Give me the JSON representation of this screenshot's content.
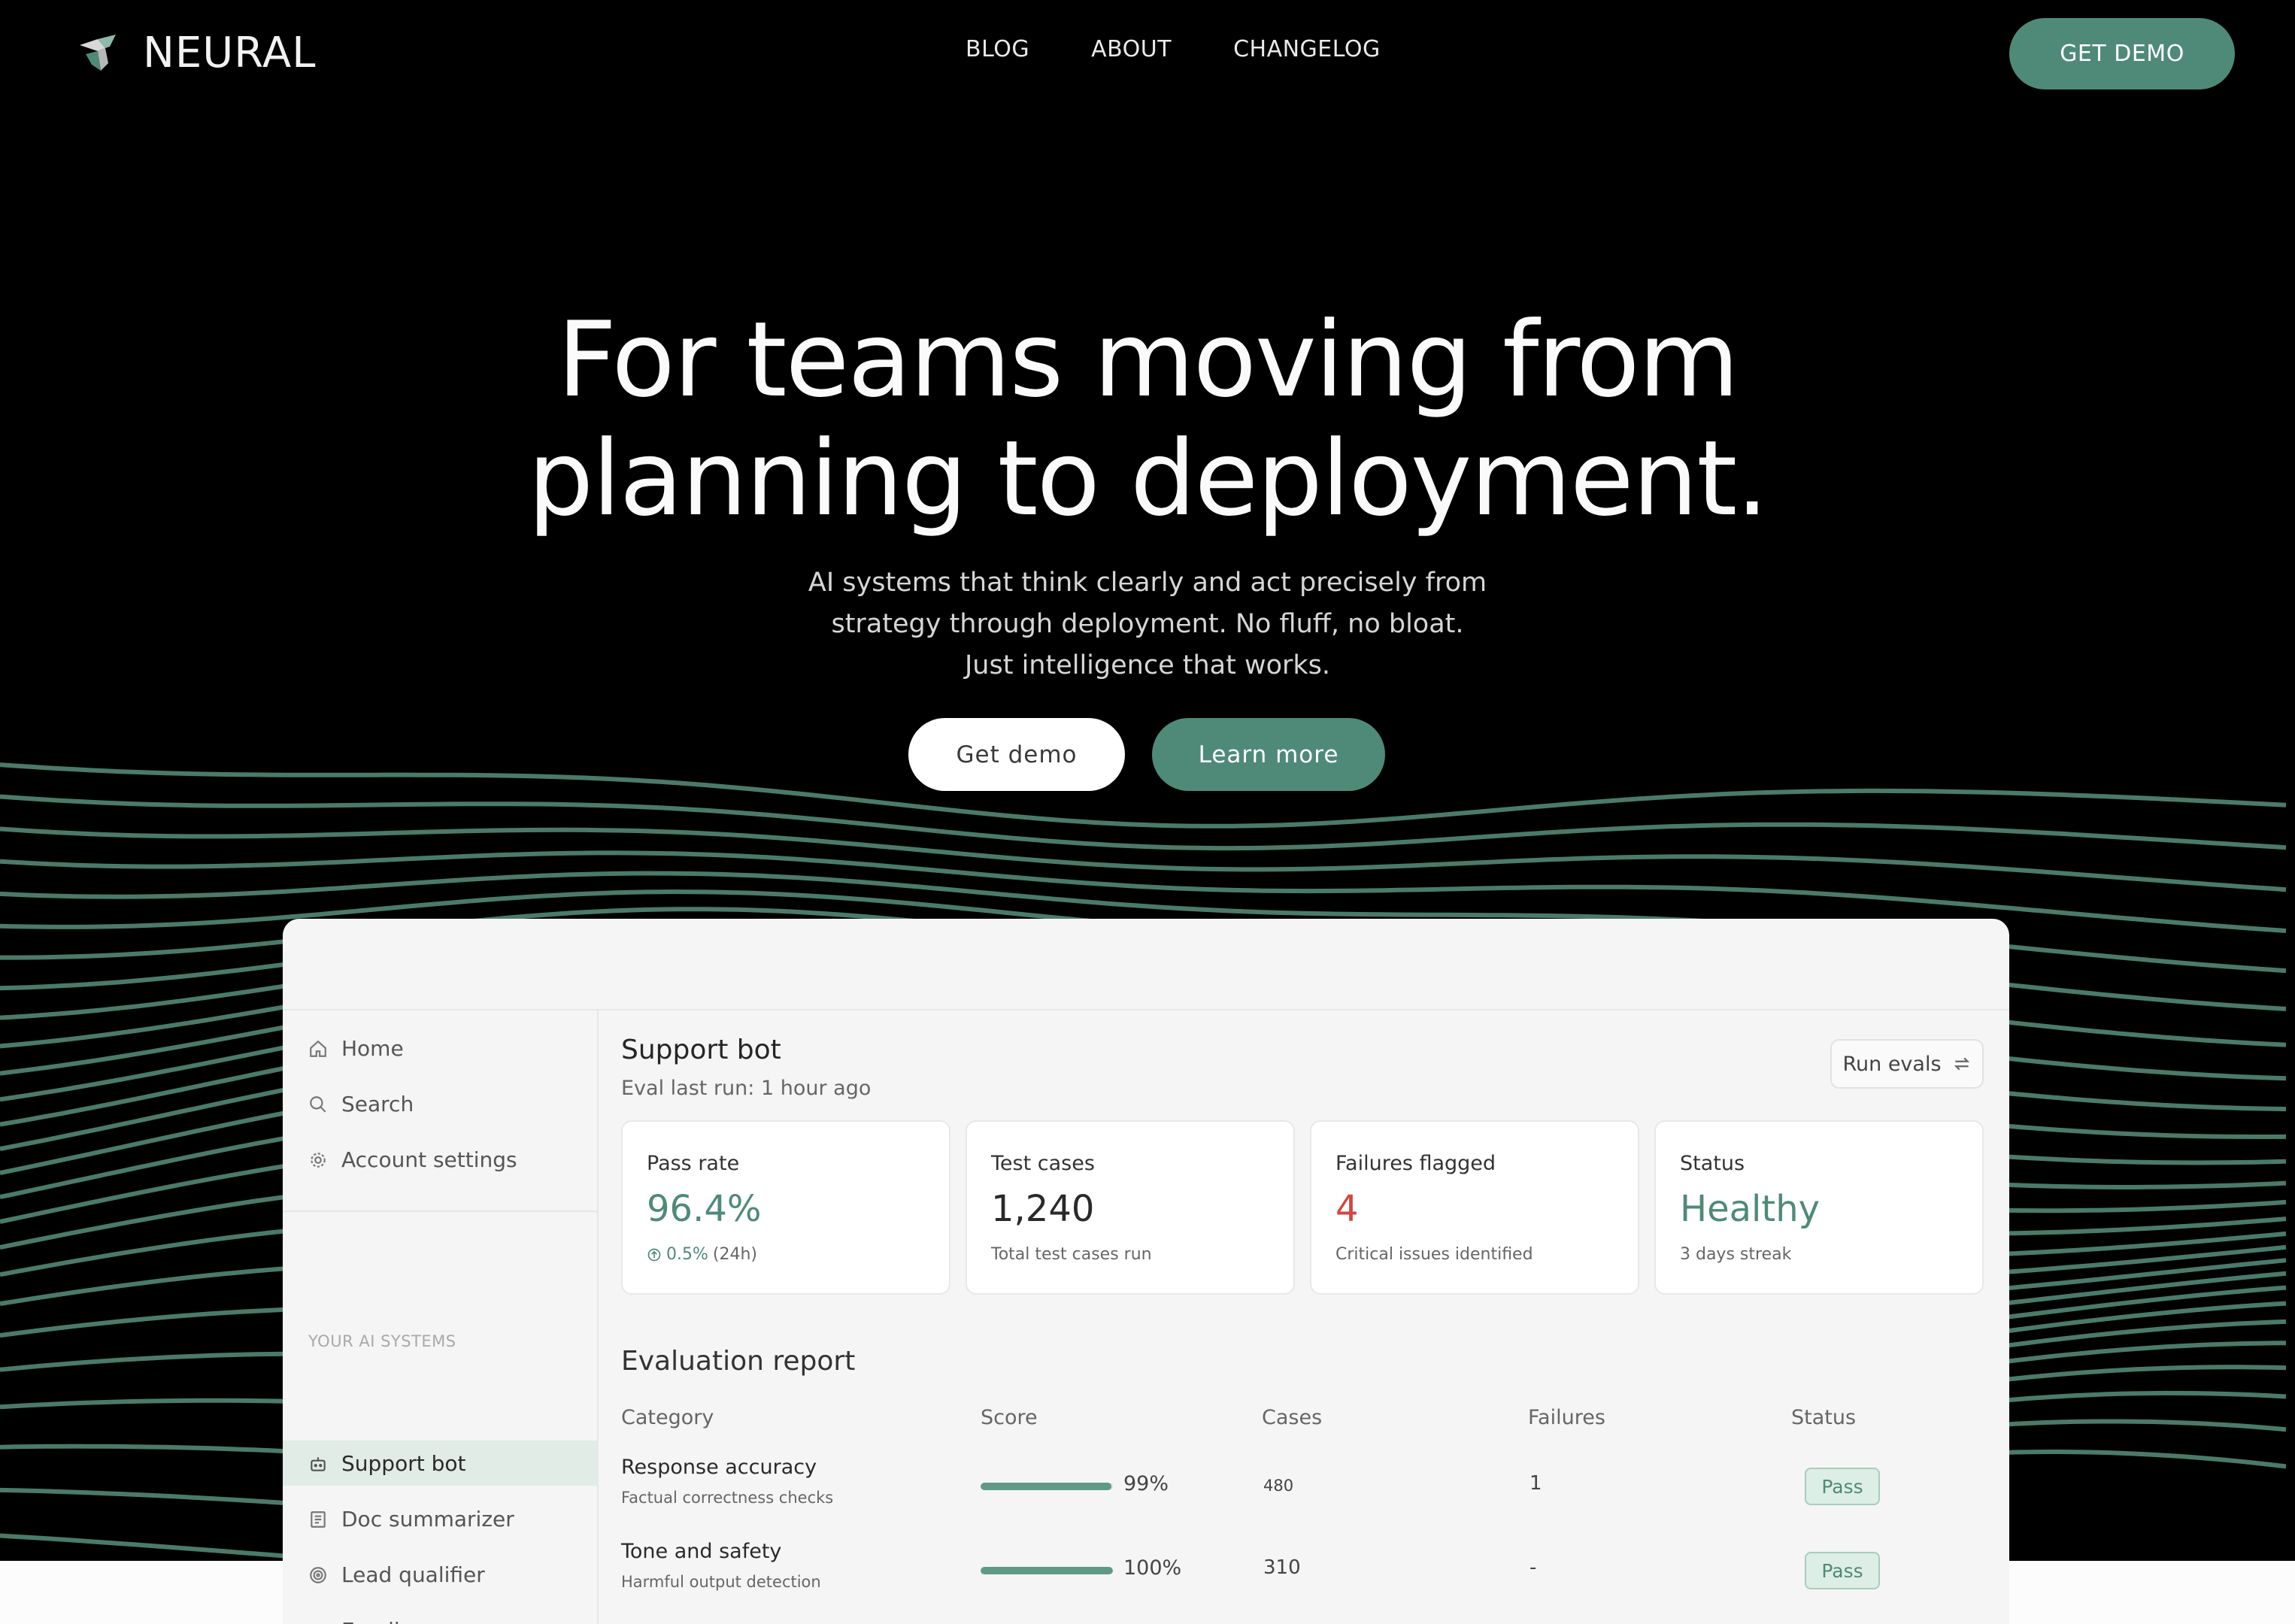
{
  "nav": {
    "brand": "NEURAL",
    "links": [
      "BLOG",
      "ABOUT",
      "CHANGELOG"
    ],
    "cta": "GET DEMO"
  },
  "hero": {
    "title_line1": "For teams moving from",
    "title_line2": "planning to deployment.",
    "sub_line1": "AI systems that think clearly and act precisely from",
    "sub_line2": "strategy through deployment. No fluff, no bloat.",
    "sub_line3": "Just intelligence that works.",
    "btn_primary": "Get demo",
    "btn_secondary": "Learn more"
  },
  "colors": {
    "accent": "#4f8a78",
    "wave": "#4a7a6c",
    "fail_red": "#d0473f"
  },
  "dashboard": {
    "sidebar": {
      "items": [
        {
          "label": "Home",
          "icon": "home-icon"
        },
        {
          "label": "Search",
          "icon": "search-icon"
        },
        {
          "label": "Account settings",
          "icon": "gear-icon"
        }
      ],
      "section_label": "YOUR AI SYSTEMS",
      "systems": [
        {
          "label": "Support bot",
          "icon": "bot-icon",
          "active": true
        },
        {
          "label": "Doc summarizer",
          "icon": "document-icon"
        },
        {
          "label": "Lead qualifier",
          "icon": "target-icon"
        },
        {
          "label": "Email composer",
          "icon": "laptop-icon"
        }
      ]
    },
    "title": "Support bot",
    "subtitle": "Eval last run: 1 hour ago",
    "run_button": "Run evals",
    "cards": [
      {
        "label": "Pass rate",
        "value": "96.4%",
        "note_value": "0.5%",
        "note_suffix": "(24h)"
      },
      {
        "label": "Test cases",
        "value": "1,240",
        "note": "Total test cases run"
      },
      {
        "label": "Failures flagged",
        "value": "4",
        "note": "Critical issues identified"
      },
      {
        "label": "Status",
        "value": "Healthy",
        "note": "3 days streak"
      }
    ],
    "report": {
      "title": "Evaluation report",
      "headers": [
        "Category",
        "Score",
        "Cases",
        "Failures",
        "Status"
      ],
      "rows": [
        {
          "category": "Response accuracy",
          "sub": "Factual correctness checks",
          "score": "99%",
          "score_fraction": 0.99,
          "cases": "480",
          "failures": "1",
          "status": "Pass"
        },
        {
          "category": "Tone and safety",
          "sub": "Harmful output detection",
          "score": "100%",
          "score_fraction": 1.0,
          "cases": "310",
          "failures": "-",
          "status": "Pass"
        }
      ]
    }
  }
}
